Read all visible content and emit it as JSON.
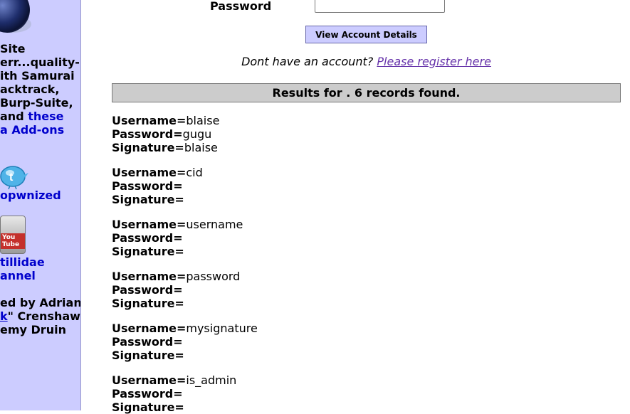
{
  "sidebar": {
    "site_lines": [
      "Site",
      "err...quality-",
      "ith Samurai",
      "acktrack,",
      "Burp-Suite,"
    ],
    "and_text": " and ",
    "these_link": "these",
    "addons_link": "a Add-ons",
    "twitter_text": "opwnized",
    "youtube_icon_text": "You Tube",
    "youtube_text_1": "tillidae",
    "youtube_text_2": "annel",
    "credits_1": "ed by Adrian",
    "credits_link": "k",
    "credits_2_rest": "\" Crenshaw",
    "credits_3": "emy Druin"
  },
  "form": {
    "password_label": "Password",
    "password_value": "",
    "submit_label": "View Account Details",
    "no_account_text": "Dont have an account?",
    "register_link": "Please register here"
  },
  "results": {
    "header": "Results for . 6 records found.",
    "field_labels": {
      "username": "Username=",
      "password": "Password=",
      "signature": "Signature="
    },
    "records": [
      {
        "username": "blaise",
        "password": "gugu",
        "signature": "blaise"
      },
      {
        "username": "cid",
        "password": "",
        "signature": ""
      },
      {
        "username": "username",
        "password": "",
        "signature": ""
      },
      {
        "username": "password",
        "password": "",
        "signature": ""
      },
      {
        "username": "mysignature",
        "password": "",
        "signature": ""
      },
      {
        "username": "is_admin",
        "password": "",
        "signature": ""
      }
    ]
  },
  "colors": {
    "sidebar_bg": "#ccccff",
    "link": "#0000cc",
    "visited_link": "#6633aa",
    "results_bar_bg": "#cccccc"
  }
}
